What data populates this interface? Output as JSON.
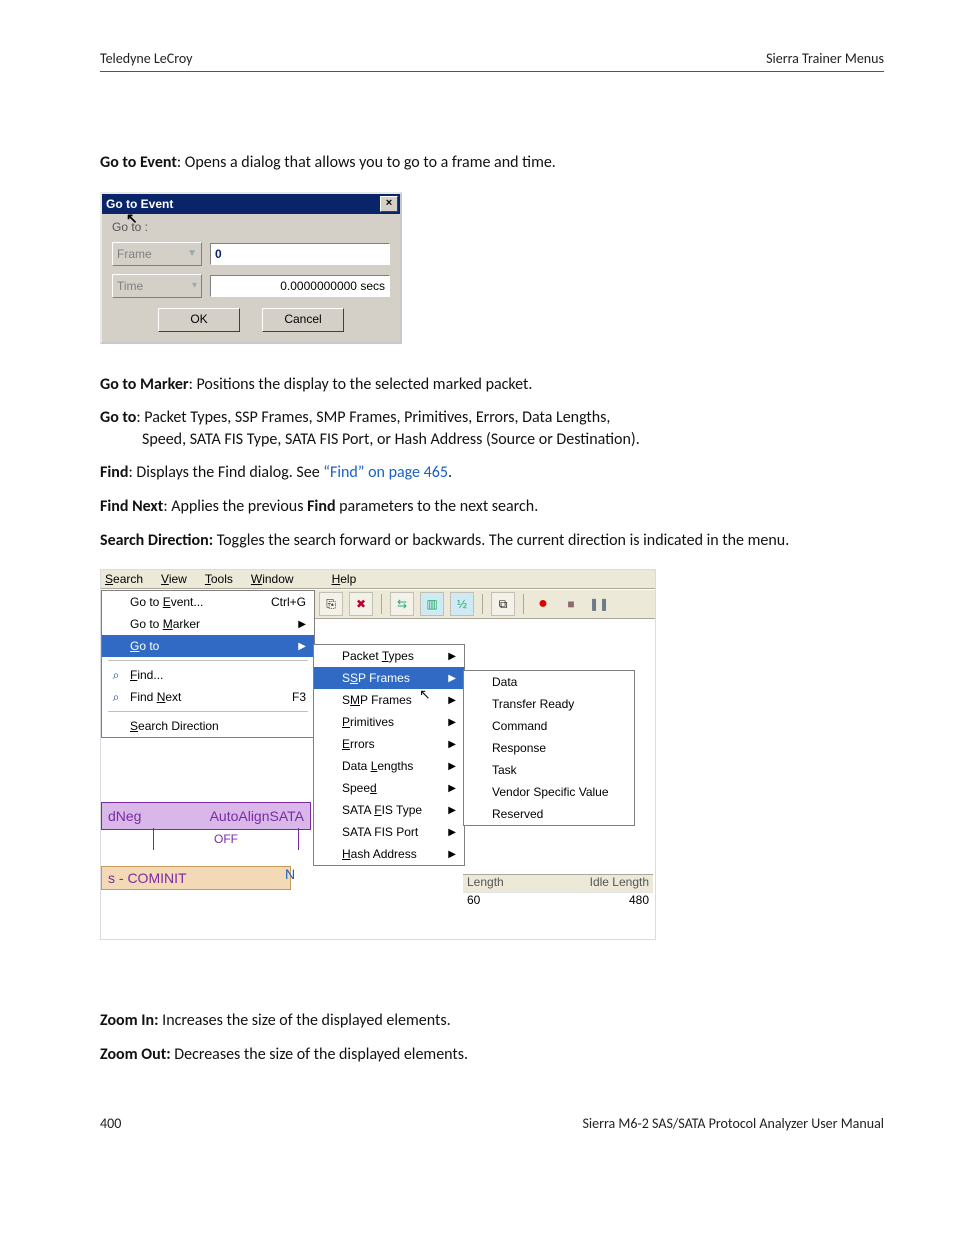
{
  "header": {
    "left": "Teledyne LeCroy",
    "right": "Sierra Trainer Menus"
  },
  "text": {
    "p1a": "Go to Event",
    "p1b": ": Opens a dialog that allows you to go to a frame and time.",
    "p2a": "Go to Marker",
    "p2b": ": Positions the display to the selected marked packet.",
    "p3a": "Go to",
    "p3b": ": Packet Types, SSP Frames, SMP Frames, Primitives, Errors, Data Lengths, ",
    "p3c": "Speed, SATA FIS Type, SATA FIS Port, or Hash Address (Source or Destination).",
    "p4a": "Find",
    "p4b": ": Displays the Find dialog. See ",
    "p4link": "“Find” on page 465",
    "p4c": ".",
    "p5a": "Find Next",
    "p5b": ": Applies the previous ",
    "p5c": "Find",
    "p5d": " parameters to the next search.",
    "p6a": "Search Direction:",
    "p6b": " Toggles the search forward or backwards. The current direction is indicated in the menu.",
    "p7a": "Zoom In:",
    "p7b": " Increases the size of the displayed elements.",
    "p8a": "Zoom Out:",
    "p8b": " Decreases the size of the displayed elements."
  },
  "dlg": {
    "title": "Go to Event",
    "label": "Go to :",
    "combo1": "Frame",
    "field1": "0",
    "combo2": "Time",
    "field2": "0.0000000000 secs",
    "ok": "OK",
    "cancel": "Cancel"
  },
  "menus": {
    "bar": [
      "Search",
      "View",
      "Tools",
      "Window",
      "Help"
    ],
    "search": [
      {
        "label": "Go to Event...",
        "shortcut": "Ctrl+G"
      },
      {
        "label": "Go to Marker",
        "sub": true
      },
      {
        "label": "Go to",
        "sub": true,
        "hover": true
      },
      {
        "sep": true
      },
      {
        "label": "Find...",
        "icon": "binoculars"
      },
      {
        "label": "Find Next",
        "shortcut": "F3",
        "icon": "binoculars-next"
      },
      {
        "sep": true
      },
      {
        "label": "Search Direction"
      }
    ],
    "goto": [
      {
        "label": "Packet Types",
        "sub": true
      },
      {
        "label": "SSP Frames",
        "sub": true,
        "hover": true
      },
      {
        "label": "SMP Frames",
        "sub": true
      },
      {
        "label": "Primitives",
        "sub": true
      },
      {
        "label": "Errors",
        "sub": true
      },
      {
        "label": "Data Lengths",
        "sub": true
      },
      {
        "label": "Speed",
        "sub": true
      },
      {
        "label": "SATA FIS Type",
        "sub": true
      },
      {
        "label": "SATA FIS Port",
        "sub": true
      },
      {
        "label": "Hash Address",
        "sub": true
      }
    ],
    "ssp": [
      "Data",
      "Transfer Ready",
      "Command",
      "Response",
      "Task",
      "Vendor Specific Value",
      "Reserved"
    ]
  },
  "strips": {
    "dneg_left": "dNeg",
    "dneg_right": "AutoAlignSATA",
    "off": "OFF",
    "cominit": "s - COMINIT",
    "cominit_n": "N",
    "len_head_l": "Length",
    "len_head_r": "Idle Length",
    "len_val_l": "60",
    "len_val_r": "480"
  },
  "footer": {
    "page": "400",
    "title": "Sierra M6-2 SAS/SATA Protocol Analyzer User Manual"
  }
}
